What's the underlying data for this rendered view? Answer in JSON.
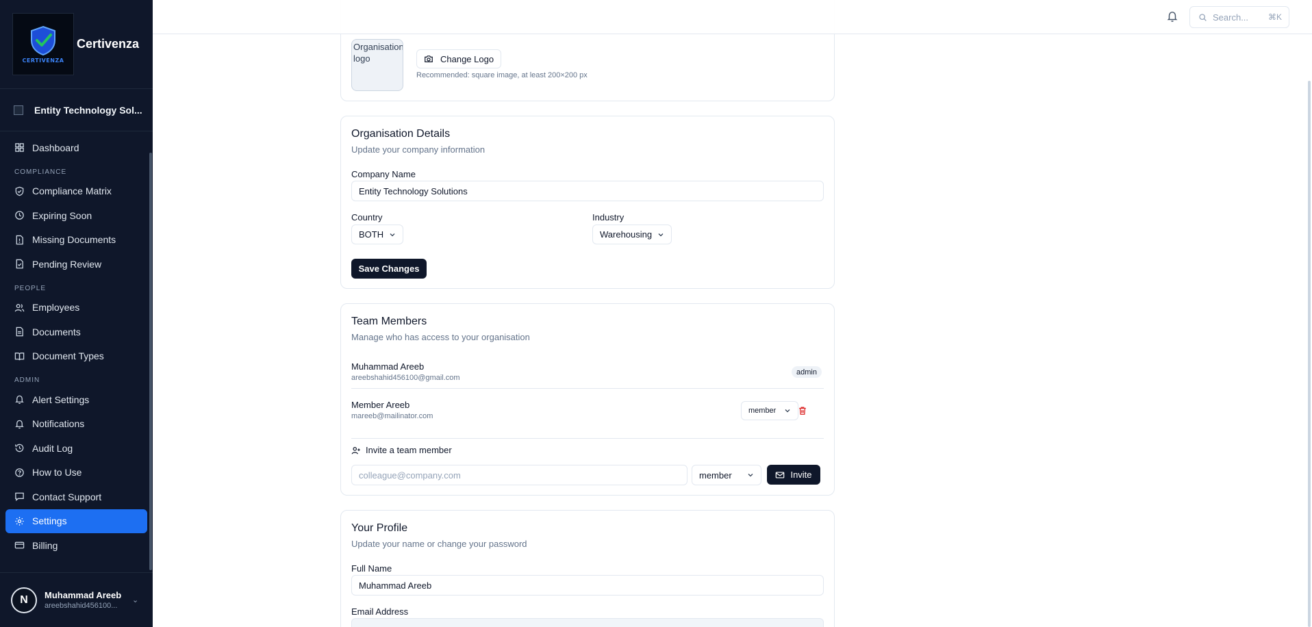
{
  "brand": {
    "name": "Certivenza",
    "logo_text": "CERTIVENZA"
  },
  "org": {
    "name": "Entity Technology Sol..."
  },
  "nav": {
    "dashboard": "Dashboard",
    "section_compliance": "COMPLIANCE",
    "compliance_matrix": "Compliance Matrix",
    "expiring_soon": "Expiring Soon",
    "missing_documents": "Missing Documents",
    "pending_review": "Pending Review",
    "section_people": "PEOPLE",
    "employees": "Employees",
    "documents": "Documents",
    "document_types": "Document Types",
    "section_admin": "ADMIN",
    "alert_settings": "Alert Settings",
    "notifications": "Notifications",
    "audit_log": "Audit Log",
    "how_to_use": "How to Use",
    "contact_support": "Contact Support",
    "settings": "Settings",
    "billing": "Billing"
  },
  "user": {
    "name": "Muhammad Areeb",
    "email": "areebshahid456100...",
    "avatar_letter": "N"
  },
  "topbar": {
    "search_placeholder": "Search...",
    "shortcut": "⌘K"
  },
  "logo_card": {
    "img_alt": "Organisation logo",
    "change_label": "Change Logo",
    "hint": "Recommended: square image, at least 200×200 px"
  },
  "org_details": {
    "title": "Organisation Details",
    "subtitle": "Update your company information",
    "company_label": "Company Name",
    "company_value": "Entity Technology Solutions",
    "country_label": "Country",
    "country_value": "BOTH",
    "industry_label": "Industry",
    "industry_value": "Warehousing",
    "save_label": "Save Changes"
  },
  "team": {
    "title": "Team Members",
    "subtitle": "Manage who has access to your organisation",
    "members": [
      {
        "name": "Muhammad Areeb",
        "email": "areebshahid456100@gmail.com",
        "role": "admin"
      },
      {
        "name": "Member Areeb",
        "email": "mareeb@mailinator.com",
        "role": "member"
      }
    ],
    "invite_title": "Invite a team member",
    "invite_placeholder": "colleague@company.com",
    "invite_role": "member",
    "invite_button": "Invite"
  },
  "profile": {
    "title": "Your Profile",
    "subtitle": "Update your name or change your password",
    "fullname_label": "Full Name",
    "fullname_value": "Muhammad Areeb",
    "email_label": "Email Address"
  },
  "colors": {
    "sidebar_bg": "#0f172a",
    "accent": "#1d6ff2",
    "danger": "#dc2626"
  }
}
